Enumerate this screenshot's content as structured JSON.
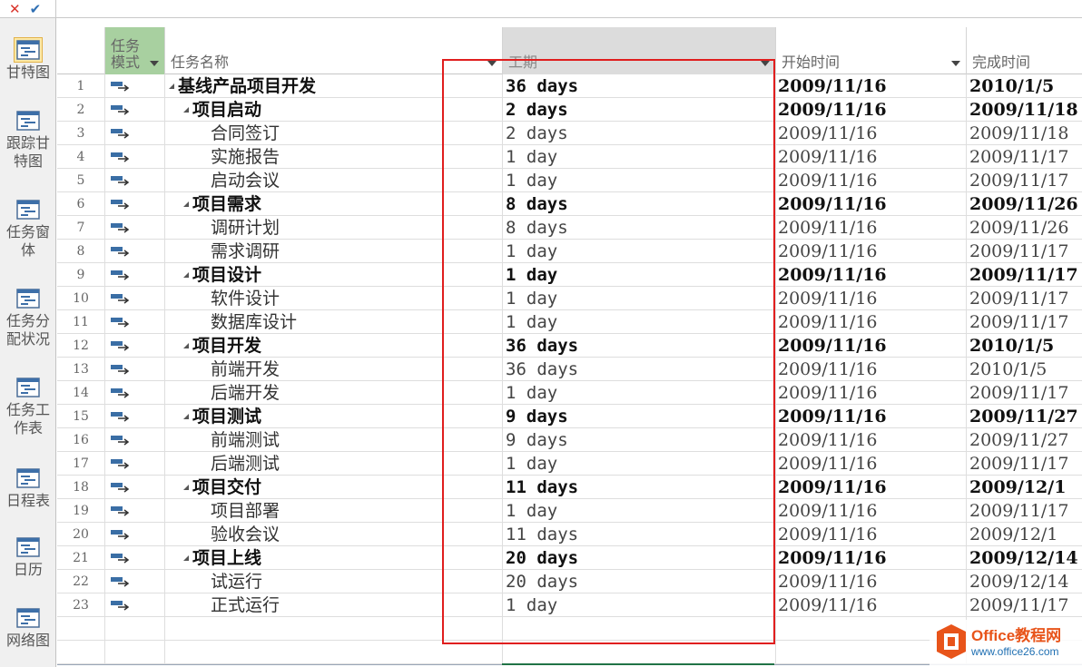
{
  "formula_bar": {
    "cancel_glyph": "✕",
    "confirm_glyph": "✔"
  },
  "views": [
    {
      "label": "甘特图",
      "icon": "gantt-chart-icon",
      "active": true
    },
    {
      "label": "跟踪甘特图",
      "icon": "tracking-gantt-icon",
      "active": false
    },
    {
      "label": "任务窗体",
      "icon": "task-form-icon",
      "active": false
    },
    {
      "label": "任务分配状况",
      "icon": "task-usage-icon",
      "active": false
    },
    {
      "label": "任务工作表",
      "icon": "task-sheet-icon",
      "active": false
    },
    {
      "label": "日程表",
      "icon": "timeline-icon",
      "active": false
    },
    {
      "label": "日历",
      "icon": "calendar-icon",
      "active": false
    },
    {
      "label": "网络图",
      "icon": "network-diagram-icon",
      "active": false
    }
  ],
  "columns": {
    "mode": "任务模式",
    "name": "任务名称",
    "duration": "工期",
    "start": "开始时间",
    "finish": "完成时间"
  },
  "tasks": [
    {
      "id": "1",
      "name": "基线产品项目开发",
      "level": 0,
      "summary": true,
      "duration": "36 days",
      "start": "2009/11/16",
      "finish": "2010/1/5"
    },
    {
      "id": "2",
      "name": "项目启动",
      "level": 1,
      "summary": true,
      "duration": "2 days",
      "start": "2009/11/16",
      "finish": "2009/11/18"
    },
    {
      "id": "3",
      "name": "合同签订",
      "level": 2,
      "summary": false,
      "duration": "2 days",
      "start": "2009/11/16",
      "finish": "2009/11/18"
    },
    {
      "id": "4",
      "name": "实施报告",
      "level": 2,
      "summary": false,
      "duration": "1 day",
      "start": "2009/11/16",
      "finish": "2009/11/17"
    },
    {
      "id": "5",
      "name": "启动会议",
      "level": 2,
      "summary": false,
      "duration": "1 day",
      "start": "2009/11/16",
      "finish": "2009/11/17"
    },
    {
      "id": "6",
      "name": "项目需求",
      "level": 1,
      "summary": true,
      "duration": "8 days",
      "start": "2009/11/16",
      "finish": "2009/11/26"
    },
    {
      "id": "7",
      "name": "调研计划",
      "level": 2,
      "summary": false,
      "duration": "8 days",
      "start": "2009/11/16",
      "finish": "2009/11/26"
    },
    {
      "id": "8",
      "name": "需求调研",
      "level": 2,
      "summary": false,
      "duration": "1 day",
      "start": "2009/11/16",
      "finish": "2009/11/17"
    },
    {
      "id": "9",
      "name": "项目设计",
      "level": 1,
      "summary": true,
      "duration": "1 day",
      "start": "2009/11/16",
      "finish": "2009/11/17"
    },
    {
      "id": "10",
      "name": "软件设计",
      "level": 2,
      "summary": false,
      "duration": "1 day",
      "start": "2009/11/16",
      "finish": "2009/11/17"
    },
    {
      "id": "11",
      "name": "数据库设计",
      "level": 2,
      "summary": false,
      "duration": "1 day",
      "start": "2009/11/16",
      "finish": "2009/11/17"
    },
    {
      "id": "12",
      "name": "项目开发",
      "level": 1,
      "summary": true,
      "duration": "36 days",
      "start": "2009/11/16",
      "finish": "2010/1/5"
    },
    {
      "id": "13",
      "name": "前端开发",
      "level": 2,
      "summary": false,
      "duration": "36 days",
      "start": "2009/11/16",
      "finish": "2010/1/5"
    },
    {
      "id": "14",
      "name": "后端开发",
      "level": 2,
      "summary": false,
      "duration": "1 day",
      "start": "2009/11/16",
      "finish": "2009/11/17"
    },
    {
      "id": "15",
      "name": "项目测试",
      "level": 1,
      "summary": true,
      "duration": "9 days",
      "start": "2009/11/16",
      "finish": "2009/11/27"
    },
    {
      "id": "16",
      "name": "前端测试",
      "level": 2,
      "summary": false,
      "duration": "9 days",
      "start": "2009/11/16",
      "finish": "2009/11/27"
    },
    {
      "id": "17",
      "name": "后端测试",
      "level": 2,
      "summary": false,
      "duration": "1 day",
      "start": "2009/11/16",
      "finish": "2009/11/17"
    },
    {
      "id": "18",
      "name": "项目交付",
      "level": 1,
      "summary": true,
      "duration": "11 days",
      "start": "2009/11/16",
      "finish": "2009/12/1"
    },
    {
      "id": "19",
      "name": "项目部署",
      "level": 2,
      "summary": false,
      "duration": "1 day",
      "start": "2009/11/16",
      "finish": "2009/11/17"
    },
    {
      "id": "20",
      "name": "验收会议",
      "level": 2,
      "summary": false,
      "duration": "11 days",
      "start": "2009/11/16",
      "finish": "2009/12/1"
    },
    {
      "id": "21",
      "name": "项目上线",
      "level": 1,
      "summary": true,
      "duration": "20 days",
      "start": "2009/11/16",
      "finish": "2009/12/14"
    },
    {
      "id": "22",
      "name": "试运行",
      "level": 2,
      "summary": false,
      "duration": "20 days",
      "start": "2009/11/16",
      "finish": "2009/12/14"
    },
    {
      "id": "23",
      "name": "正式运行",
      "level": 2,
      "summary": false,
      "duration": "1 day",
      "start": "2009/11/16",
      "finish": "2009/11/17"
    }
  ],
  "watermark": {
    "title": "Office教程网",
    "url": "www.office26.com"
  },
  "colors": {
    "highlight_box": "#e01e1e",
    "mode_icon": "#3a6ea5",
    "watermark_orange": "#e8541a"
  }
}
